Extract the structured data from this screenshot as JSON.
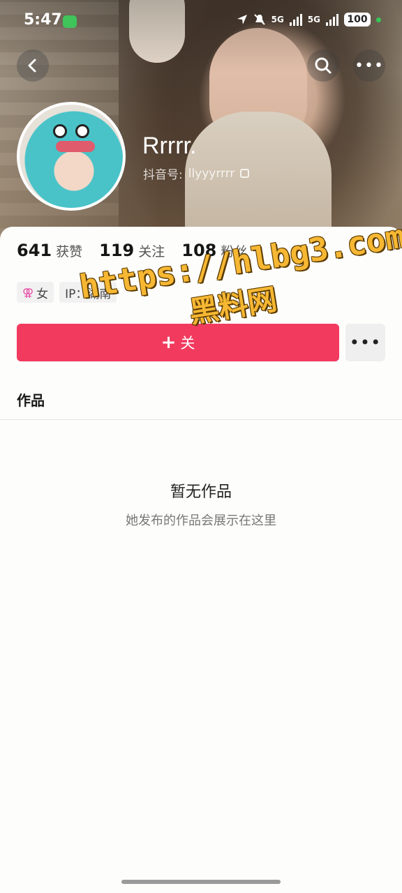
{
  "status_bar": {
    "time": "5:47",
    "network_1": "5G",
    "network_2": "5G",
    "battery": "100"
  },
  "icons": {
    "back": "chevron-left-icon",
    "search": "search-icon",
    "more": "more-dots-icon",
    "copy": "copy-icon",
    "female": "female-icon",
    "plus": "plus-icon"
  },
  "profile": {
    "nickname": "Rrrrr.",
    "douyin_id_label": "抖音号:",
    "douyin_id": "llyyyrrrr"
  },
  "stats": [
    {
      "value": "641",
      "label": "获赞"
    },
    {
      "value": "119",
      "label": "关注"
    },
    {
      "value": "108",
      "label": "粉丝"
    }
  ],
  "tags": {
    "gender_symbol": "⚢",
    "gender": "女",
    "ip": "IP：湖南"
  },
  "actions": {
    "follow_label": "关",
    "more_label": "•••"
  },
  "tabs": {
    "works": "作品"
  },
  "empty_state": {
    "title": "暂无作品",
    "subtitle": "她发布的作品会展示在这里"
  },
  "watermark": {
    "url": "https://hlbg3.com",
    "text": "黑料网"
  },
  "colors": {
    "accent": "#f23a5f",
    "watermark": "#f6b733"
  }
}
